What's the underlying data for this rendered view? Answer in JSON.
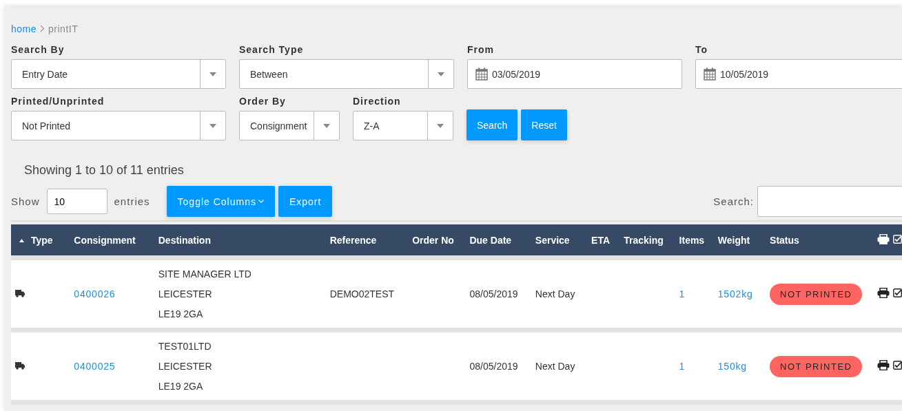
{
  "breadcrumb": {
    "link": "home",
    "current": "printIT"
  },
  "filters_row1": [
    {
      "kind": "select",
      "label": "Search By",
      "value": "Entry Date"
    },
    {
      "kind": "select",
      "label": "Search Type",
      "value": "Between"
    },
    {
      "kind": "date",
      "label": "From",
      "value": "03/05/2019"
    },
    {
      "kind": "date",
      "label": "To",
      "value": "10/05/2019"
    }
  ],
  "filters_row2": [
    {
      "kind": "select",
      "label": "Printed/Unprinted",
      "value": "Not Printed"
    },
    {
      "kind": "short_select",
      "label": "Order By",
      "value": "Consignment"
    },
    {
      "kind": "short_select",
      "label": "Direction",
      "value": "Z-A"
    }
  ],
  "filter_buttons": [
    "Search",
    "Reset"
  ],
  "info": "Showing 1 to 10 of 11 entries",
  "length": {
    "before": "Show",
    "value": "10",
    "after": "entries"
  },
  "table_buttons": [
    {
      "label": "Toggle Columns",
      "dropdown": true
    },
    {
      "label": "Export",
      "dropdown": false
    }
  ],
  "search": {
    "label": "Search:"
  },
  "table": {
    "columns": [
      {
        "label": "Type",
        "sorted": true
      },
      {
        "label": "Consignment",
        "sorted": false
      },
      {
        "label": "Destination",
        "sorted": false
      },
      {
        "label": "Reference",
        "sorted": false
      },
      {
        "label": "Order No",
        "sorted": false
      },
      {
        "label": "Due Date",
        "sorted": false
      },
      {
        "label": "Service",
        "sorted": false
      },
      {
        "label": "ETA",
        "sorted": false
      },
      {
        "label": "Tracking",
        "sorted": false
      },
      {
        "label": "Items",
        "sorted": false
      },
      {
        "label": "Weight",
        "sorted": false
      },
      {
        "label": "Status",
        "sorted": false
      },
      {
        "kind": "actions",
        "sorted": false
      }
    ],
    "rows": [
      {
        "consignment": "0400026",
        "destination": [
          "SITE MANAGER LTD",
          "LEICESTER",
          "LE19 2GA"
        ],
        "reference": "DEMO02TEST",
        "due_date": "08/05/2019",
        "service": "Next Day",
        "items": "1",
        "weight": "1502kg",
        "status": {
          "label": "NOT PRINTED",
          "printed": false
        }
      },
      {
        "consignment": "0400025",
        "destination": [
          "TEST01LTD",
          "LEICESTER",
          "LE19 2GA"
        ],
        "due_date": "08/05/2019",
        "service": "Next Day",
        "items": "1",
        "weight": "150kg",
        "status": {
          "label": "NOT PRINTED",
          "printed": false
        }
      }
    ]
  }
}
